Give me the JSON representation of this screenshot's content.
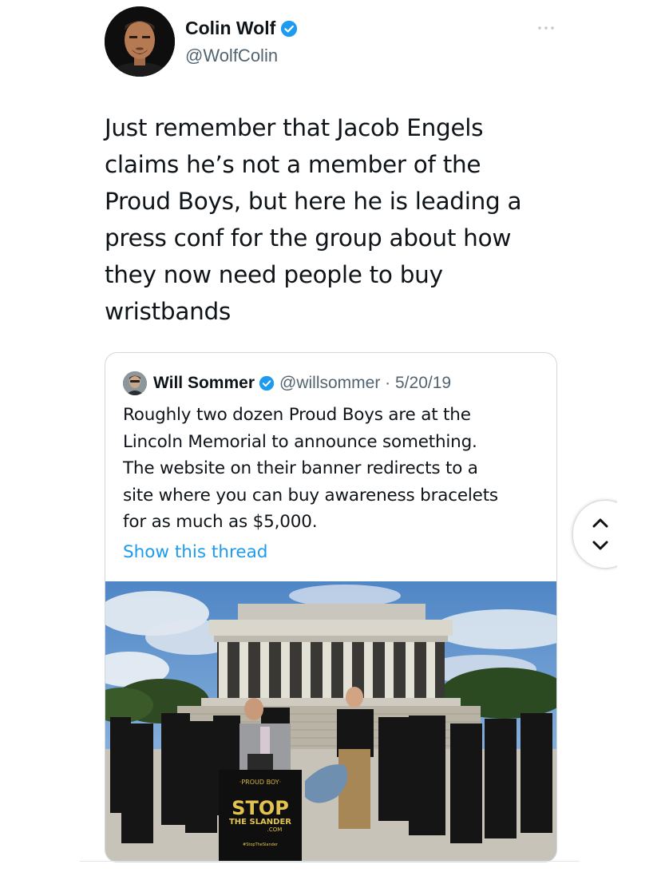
{
  "author": {
    "name": "Colin Wolf",
    "handle": "@WolfColin"
  },
  "tweet": {
    "lines": [
      "Just remember that Jacob Engels",
      "claims he’s not a member of the",
      "Proud Boys, but here he is leading a",
      "press conf for the group about how",
      "they now need people to buy",
      "wristbands"
    ]
  },
  "quote": {
    "name": "Will Sommer",
    "handle_date": "@willsommer · 5/20/19",
    "lines": [
      "Roughly two dozen Proud Boys are at the",
      "Lincoln Memorial to announce something.",
      "The website on their banner redirects to a",
      "site where you can buy awareness bracelets",
      "for as much as $5,000."
    ],
    "thread_link": "Show this thread",
    "photo": {
      "banner_top": "·PROUD BOY·",
      "banner_main": "STOP",
      "banner_sub": "THE SLANDER",
      "banner_com": ".COM",
      "banner_tag": "#StopTheSlander"
    }
  },
  "colors": {
    "verified": "#1d9bf0",
    "link": "#1d9bf0",
    "text": "#0f1419",
    "secondary": "#536471"
  },
  "icons": {
    "verified": "verified-badge-icon",
    "more": "more-options-icon",
    "pager_up": "chevron-up-icon",
    "pager_down": "chevron-down-icon"
  }
}
